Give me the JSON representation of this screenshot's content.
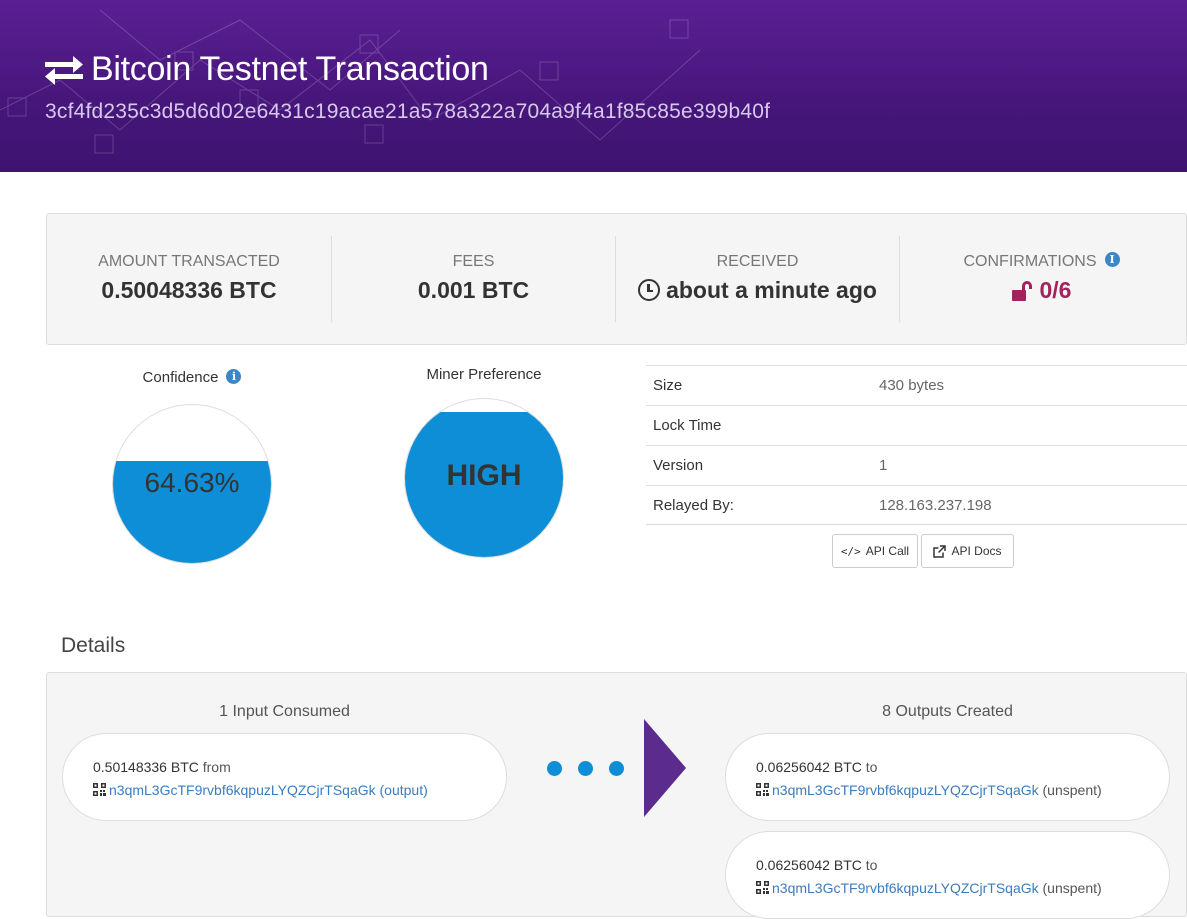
{
  "header": {
    "title": "Bitcoin Testnet Transaction",
    "hash": "3cf4fd235c3d5d6d02e6431c19acae21a578a322a704a9f4a1f85c85e399b40f",
    "icon": "exchange-arrows-icon"
  },
  "summary": {
    "amount_label": "AMOUNT TRANSACTED",
    "amount_value": "0.50048336 BTC",
    "fees_label": "FEES",
    "fees_value": "0.001 BTC",
    "received_label": "RECEIVED",
    "received_value": "about a minute ago",
    "confirmations_label": "CONFIRMATIONS",
    "confirmations_value": "0/6"
  },
  "confidence": {
    "label": "Confidence",
    "value": "64.63%",
    "fill_percent": 64.63
  },
  "miner_preference": {
    "label": "Miner Preference",
    "value": "HIGH",
    "fill_percent": 92
  },
  "properties": [
    {
      "key": "Size",
      "value": "430 bytes"
    },
    {
      "key": "Lock Time",
      "value": ""
    },
    {
      "key": "Version",
      "value": "1"
    },
    {
      "key": "Relayed By:",
      "value": "128.163.237.198"
    }
  ],
  "buttons": {
    "api_call": "API Call",
    "api_docs": "API Docs"
  },
  "details": {
    "title": "Details",
    "inputs_title": "1 Input Consumed",
    "outputs_title": "8 Outputs Created",
    "inputs": [
      {
        "amount": "0.50148336 BTC",
        "connector": "from",
        "address": "n3qmL3GcTF9rvbf6kqpuzLYQZCjrTSqaGk",
        "status": "(output)"
      }
    ],
    "outputs": [
      {
        "amount": "0.06256042 BTC",
        "connector": "to",
        "address": "n3qmL3GcTF9rvbf6kqpuzLYQZCjrTSqaGk",
        "status": "(unspent)"
      },
      {
        "amount": "0.06256042 BTC",
        "connector": "to",
        "address": "n3qmL3GcTF9rvbf6kqpuzLYQZCjrTSqaGk",
        "status": "(unspent)"
      }
    ]
  },
  "colors": {
    "header": "#4b1880",
    "accent_blue": "#0e8ed6",
    "confirmations": "#a4225b",
    "arrow": "#5b2b8e",
    "link": "#3a7cc0"
  }
}
